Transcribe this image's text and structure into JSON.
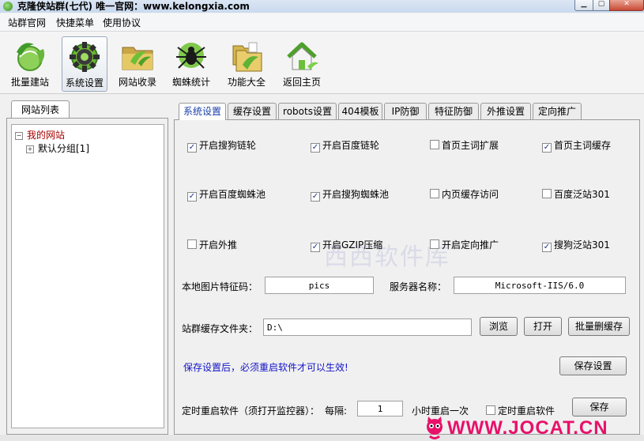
{
  "window": {
    "title": "克隆侠站群(七代)  唯一官网：www.kelongxia.com"
  },
  "menu": [
    "站群官网",
    "快捷菜单",
    "使用协议"
  ],
  "toolbar": [
    {
      "label": "批量建站",
      "icon": "globe-leaf-icon"
    },
    {
      "label": "系统设置",
      "icon": "gear-icon"
    },
    {
      "label": "网站收录",
      "icon": "folder-icon"
    },
    {
      "label": "蜘蛛统计",
      "icon": "spider-icon"
    },
    {
      "label": "功能大全",
      "icon": "folders-icon"
    },
    {
      "label": "返回主页",
      "icon": "home-icon"
    }
  ],
  "left_panel": {
    "tab": "网站列表",
    "tree": [
      {
        "label": "我的网站",
        "expander": "⊟",
        "color": "#a80000"
      },
      {
        "label": "默认分组[1]",
        "expander": "⊞",
        "color": "#000000"
      }
    ]
  },
  "tabs": [
    "系统设置",
    "缓存设置",
    "robots设置",
    "404模板",
    "IP防御",
    "特征防御",
    "外推设置",
    "定向推广"
  ],
  "checkboxes": [
    [
      {
        "label": "开启搜狗链轮",
        "checked": true
      },
      {
        "label": "开启百度链轮",
        "checked": true
      },
      {
        "label": "首页主词扩展",
        "checked": false
      },
      {
        "label": "首页主词缓存",
        "checked": true
      }
    ],
    [
      {
        "label": "开启百度蜘蛛池",
        "checked": true
      },
      {
        "label": "开启搜狗蜘蛛池",
        "checked": true
      },
      {
        "label": "内页缓存访问",
        "checked": false
      },
      {
        "label": "百度泛站301",
        "checked": false
      }
    ],
    [
      {
        "label": "开启外推",
        "checked": false
      },
      {
        "label": "开启GZIP压缩",
        "checked": true
      },
      {
        "label": "开启定向推广",
        "checked": false
      },
      {
        "label": "搜狗泛站301",
        "checked": true
      }
    ]
  ],
  "form": {
    "img_code_label": "本地图片特征码：",
    "img_code_value": "pics",
    "server_name_label": "服务器名称：",
    "server_name_value": "Microsoft-IIS/6.0",
    "cache_folder_label": "站群缓存文件夹：",
    "cache_folder_value": "D:\\",
    "browse_label": "浏览",
    "open_label": "打开",
    "batch_delete_label": "批量删缓存",
    "notice": "保存设置后，必须重启软件才可以生效!",
    "save_settings_label": "保存设置",
    "timer_label": "定时重启软件（须打开监控器）：",
    "interval_label": "每隔:",
    "interval_value": "1",
    "hours_label": "小时重启一次",
    "timer_checkbox_label": "定时重启软件",
    "save_label": "保存"
  },
  "watermark": "西西软件库",
  "footer_logo": "WWW.JOCAT.CN"
}
